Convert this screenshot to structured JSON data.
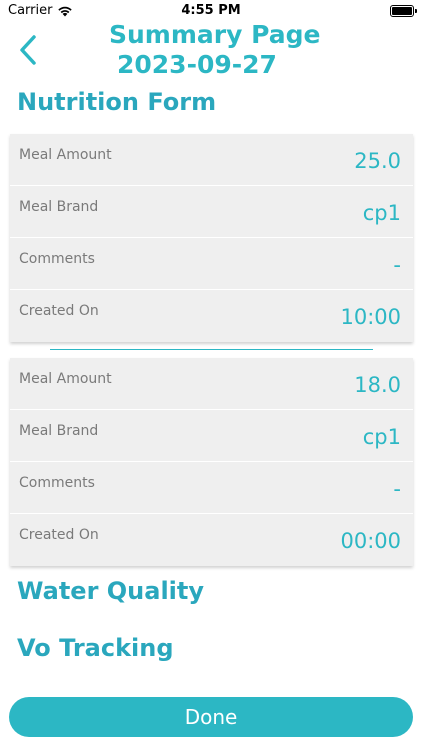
{
  "status_bar": {
    "carrier": "Carrier",
    "wifi_icon": "wifi-icon",
    "time": "4:55 PM",
    "battery_icon": "battery-icon"
  },
  "header": {
    "back_icon": "chevron-left-icon",
    "title": "Summary Page",
    "date": "2023-09-27"
  },
  "sections": {
    "nutrition": "Nutrition Form",
    "water": "Water Quality",
    "vo": "Vo Tracking"
  },
  "nutrition_entries": [
    {
      "meal_amount_label": "Meal Amount",
      "meal_amount": "25.0",
      "meal_brand_label": "Meal Brand",
      "meal_brand": "cp1",
      "comments_label": "Comments",
      "comments": "-",
      "created_on_label": "Created On",
      "created_on": "10:00"
    },
    {
      "meal_amount_label": "Meal Amount",
      "meal_amount": "18.0",
      "meal_brand_label": "Meal Brand",
      "meal_brand": "cp1",
      "comments_label": "Comments",
      "comments": "-",
      "created_on_label": "Created On",
      "created_on": "00:00"
    }
  ],
  "done_label": "Done",
  "colors": {
    "accent": "#2cb7c4",
    "heading": "#2aa7bd",
    "card_bg": "#efefef",
    "label": "#7a7a7a"
  }
}
